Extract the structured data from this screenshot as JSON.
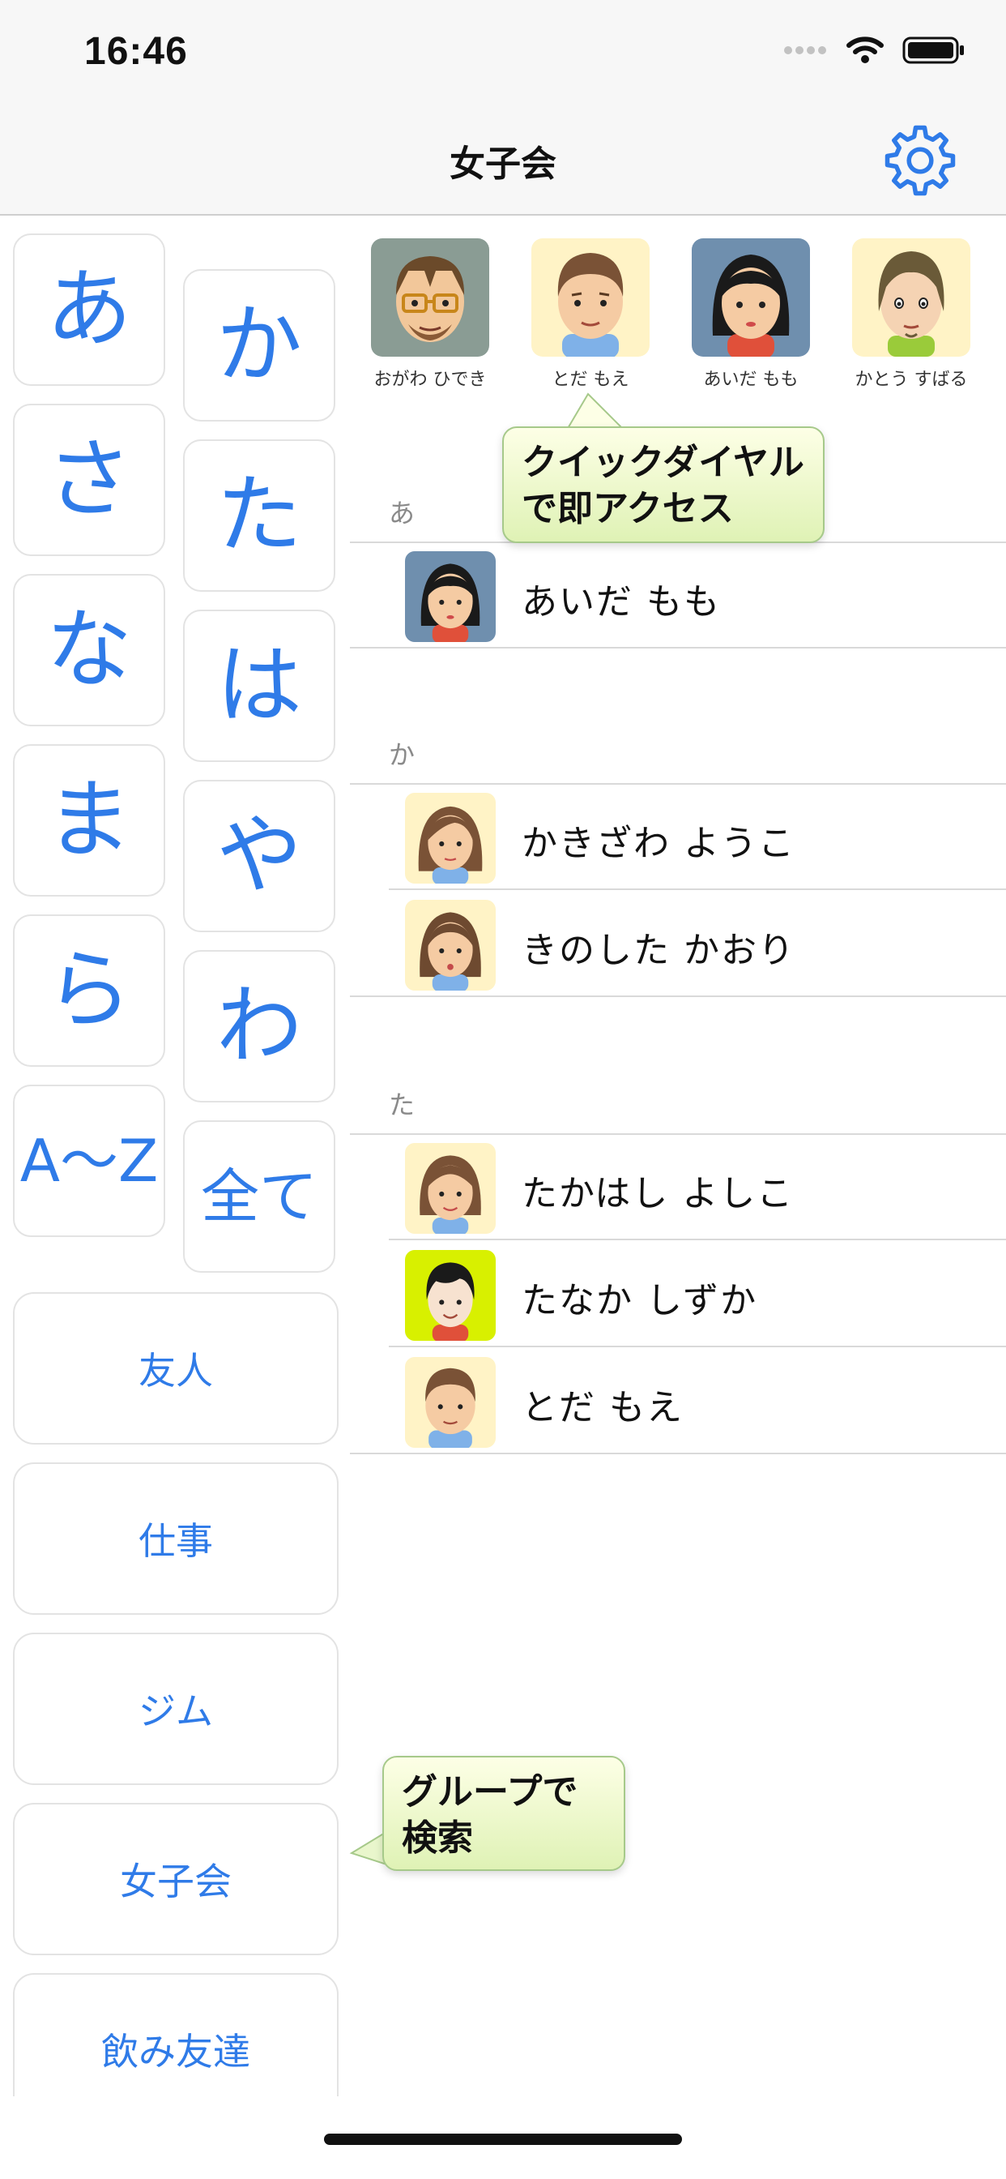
{
  "status": {
    "time": "16:46"
  },
  "nav": {
    "title": "女子会"
  },
  "kana": [
    "あ",
    "か",
    "さ",
    "た",
    "な",
    "は",
    "ま",
    "や",
    "ら",
    "わ",
    "A〜Z",
    "全て"
  ],
  "groups": [
    "友人",
    "仕事",
    "ジム",
    "女子会",
    "飲み友達"
  ],
  "quick_dial": [
    {
      "name": "おがわ ひでき"
    },
    {
      "name": "とだ もえ"
    },
    {
      "name": "あいだ もも"
    },
    {
      "name": "かとう すばる"
    }
  ],
  "sections": [
    {
      "letter": "あ",
      "contacts": [
        {
          "name": "あいだ もも"
        }
      ]
    },
    {
      "letter": "か",
      "contacts": [
        {
          "name": "かきざわ ようこ"
        },
        {
          "name": "きのした かおり"
        }
      ]
    },
    {
      "letter": "た",
      "contacts": [
        {
          "name": "たかはし よしこ"
        },
        {
          "name": "たなか しずか"
        },
        {
          "name": "とだ もえ"
        }
      ]
    }
  ],
  "callouts": {
    "quick": "クイックダイヤル\nで即アクセス",
    "group": "グループで\n検索"
  },
  "colors": {
    "accent": "#2f7be8",
    "callout_bg": "#e6f5c3"
  }
}
